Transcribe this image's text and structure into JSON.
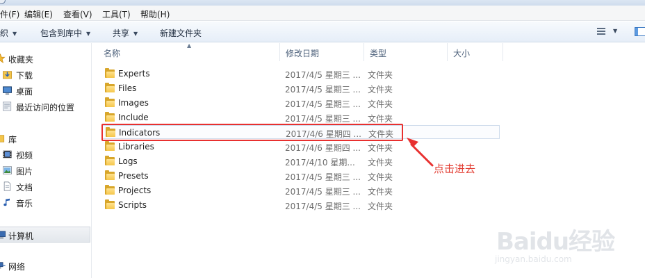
{
  "menubar": {
    "items": [
      "件(F)",
      "编辑(E)",
      "查看(V)",
      "工具(T)",
      "帮助(H)"
    ]
  },
  "toolbar": {
    "organize": "织",
    "include_in_library": "包含到库中",
    "share": "共享",
    "new_folder": "新建文件夹"
  },
  "nav": {
    "favorites": "收藏夹",
    "downloads": "下载",
    "desktop": "桌面",
    "recent": "最近访问的位置",
    "libraries": "库",
    "videos": "视频",
    "pictures": "图片",
    "documents": "文档",
    "music": "音乐",
    "computer": "计算机",
    "network": "网络"
  },
  "columns": {
    "name": "名称",
    "modified": "修改日期",
    "type": "类型",
    "size": "大小"
  },
  "files": [
    {
      "name": "Experts",
      "date": "2017/4/5 星期三 ...",
      "type": "文件夹"
    },
    {
      "name": "Files",
      "date": "2017/4/5 星期三 ...",
      "type": "文件夹"
    },
    {
      "name": "Images",
      "date": "2017/4/5 星期三 ...",
      "type": "文件夹"
    },
    {
      "name": "Include",
      "date": "2017/4/5 星期三 ...",
      "type": "文件夹"
    },
    {
      "name": "Indicators",
      "date": "2017/4/6 星期四 ...",
      "type": "文件夹"
    },
    {
      "name": "Libraries",
      "date": "2017/4/6 星期四 ...",
      "type": "文件夹"
    },
    {
      "name": "Logs",
      "date": "2017/4/10 星期...",
      "type": "文件夹"
    },
    {
      "name": "Presets",
      "date": "2017/4/5 星期三 ...",
      "type": "文件夹"
    },
    {
      "name": "Projects",
      "date": "2017/4/5 星期三 ...",
      "type": "文件夹"
    },
    {
      "name": "Scripts",
      "date": "2017/4/5 星期三 ...",
      "type": "文件夹"
    }
  ],
  "annotation": {
    "text": "点击进去",
    "color": "#e8302f"
  },
  "watermark": {
    "text": "Baidu经验",
    "url": "jingyan.baidu.com"
  }
}
